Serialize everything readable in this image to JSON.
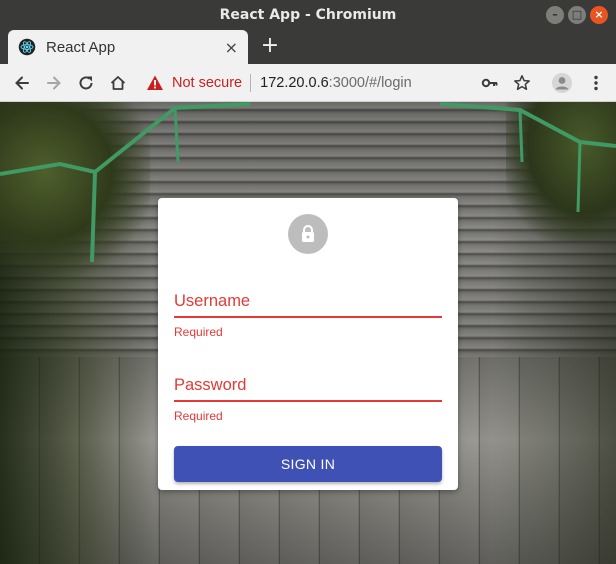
{
  "window": {
    "title": "React App - Chromium",
    "controls": {
      "minimize": "–",
      "maximize": "□",
      "close": "×"
    }
  },
  "tab": {
    "title": "React App",
    "favicon": "react-logo-icon",
    "close": "×"
  },
  "new_tab": "+",
  "toolbar": {
    "security_label": "Not secure",
    "url_host": "172.20.0.6",
    "url_rest": ":3000/#/login",
    "icons": [
      "back-arrow-icon",
      "forward-arrow-icon",
      "reload-icon",
      "home-icon",
      "warning-icon",
      "key-icon",
      "star-icon",
      "profile-icon",
      "menu-dots-icon"
    ]
  },
  "login": {
    "username_label": "Username",
    "username_helper": "Required",
    "password_label": "Password",
    "password_helper": "Required",
    "submit_label": "SIGN IN"
  },
  "colors": {
    "error": "#e53935",
    "primary": "#3f51b5",
    "avatar": "#bdbdbd",
    "not_secure": "#c5221f"
  }
}
